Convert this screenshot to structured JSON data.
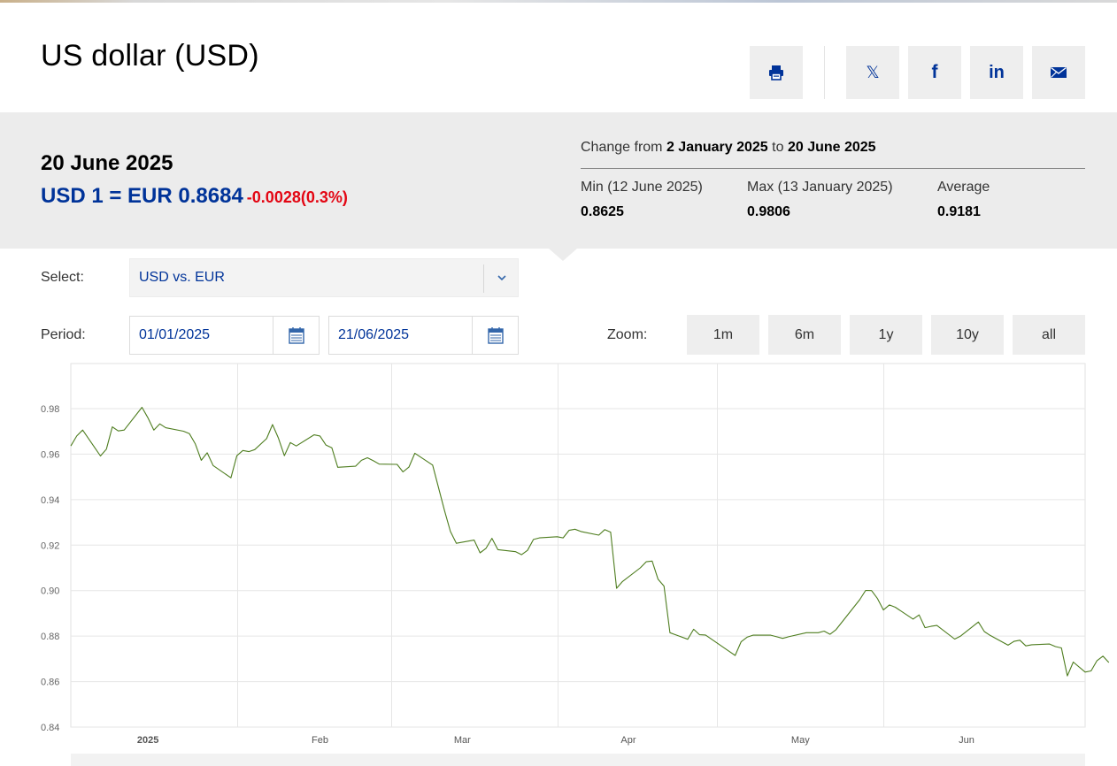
{
  "page": {
    "title": "US dollar (USD)"
  },
  "share": {
    "print_icon": "print-icon",
    "x_icon": "x-icon",
    "facebook_icon": "facebook-icon",
    "linkedin_icon": "linkedin-icon",
    "email_icon": "email-icon"
  },
  "summary": {
    "date": "20 June 2025",
    "rate": "USD 1 = EUR 0.8684",
    "change": "-0.0028(0.3%)",
    "change_color": "#e30613",
    "change_from_label": "Change from",
    "from_date": "2 January 2025",
    "to_label": "to",
    "to_date": "20 June 2025",
    "min_label": "Min (12 June 2025)",
    "min_value": "0.8625",
    "max_label": "Max (13 January 2025)",
    "max_value": "0.9806",
    "avg_label": "Average",
    "avg_value": "0.9181"
  },
  "form": {
    "select_label": "Select:",
    "select_value": "USD vs. EUR",
    "period_label": "Period:",
    "period_from": "01/01/2025",
    "period_to": "21/06/2025",
    "zoom_label": "Zoom:",
    "zoom_options": [
      "1m",
      "6m",
      "1y",
      "10y",
      "all"
    ]
  },
  "colors": {
    "brand": "#003399",
    "series": "#4e7d1f",
    "panel": "#ececec"
  },
  "chart_data": {
    "type": "line",
    "title": "",
    "xlabel": "",
    "ylabel": "",
    "ylim": [
      0.84,
      0.99
    ],
    "yticks": [
      "0.98",
      "0.96",
      "0.94",
      "0.92",
      "0.90",
      "0.88",
      "0.86",
      "0.84"
    ],
    "xticks": [
      "2025",
      "Feb",
      "Mar",
      "Apr",
      "May",
      "Jun"
    ],
    "xlim": [
      "2025-01-01",
      "2025-06-21"
    ],
    "grid": true,
    "series": [
      {
        "points": [
          [
            "2025-01-01",
            0.9636
          ],
          [
            "2025-01-02",
            0.968
          ],
          [
            "2025-01-03",
            0.9706
          ],
          [
            "2025-01-06",
            0.9592
          ],
          [
            "2025-01-07",
            0.9622
          ],
          [
            "2025-01-08",
            0.972
          ],
          [
            "2025-01-09",
            0.9702
          ],
          [
            "2025-01-10",
            0.9706
          ],
          [
            "2025-01-13",
            0.9806
          ],
          [
            "2025-01-14",
            0.976
          ],
          [
            "2025-01-15",
            0.9706
          ],
          [
            "2025-01-16",
            0.9733
          ],
          [
            "2025-01-17",
            0.9716
          ],
          [
            "2025-01-20",
            0.9701
          ],
          [
            "2025-01-21",
            0.969
          ],
          [
            "2025-01-22",
            0.9645
          ],
          [
            "2025-01-23",
            0.9573
          ],
          [
            "2025-01-24",
            0.9606
          ],
          [
            "2025-01-25",
            0.955
          ],
          [
            "2025-01-28",
            0.9496
          ],
          [
            "2025-01-29",
            0.9593
          ],
          [
            "2025-01-30",
            0.9616
          ],
          [
            "2025-01-31",
            0.9611
          ],
          [
            "2025-02-01",
            0.962
          ],
          [
            "2025-02-03",
            0.9668
          ],
          [
            "2025-02-04",
            0.973
          ],
          [
            "2025-02-05",
            0.967
          ],
          [
            "2025-02-06",
            0.9593
          ],
          [
            "2025-02-07",
            0.9651
          ],
          [
            "2025-02-08",
            0.9636
          ],
          [
            "2025-02-11",
            0.9685
          ],
          [
            "2025-02-12",
            0.968
          ],
          [
            "2025-02-13",
            0.964
          ],
          [
            "2025-02-14",
            0.9628
          ],
          [
            "2025-02-15",
            0.9542
          ],
          [
            "2025-02-18",
            0.9547
          ],
          [
            "2025-02-19",
            0.9573
          ],
          [
            "2025-02-20",
            0.9584
          ],
          [
            "2025-02-21",
            0.9571
          ],
          [
            "2025-02-22",
            0.9556
          ],
          [
            "2025-02-25",
            0.9555
          ],
          [
            "2025-02-26",
            0.9522
          ],
          [
            "2025-02-27",
            0.9543
          ],
          [
            "2025-02-28",
            0.9604
          ],
          [
            "2025-03-03",
            0.9552
          ],
          [
            "2025-03-05",
            0.9352
          ],
          [
            "2025-03-06",
            0.926
          ],
          [
            "2025-03-07",
            0.9208
          ],
          [
            "2025-03-10",
            0.9222
          ],
          [
            "2025-03-11",
            0.9166
          ],
          [
            "2025-03-12",
            0.9186
          ],
          [
            "2025-03-13",
            0.923
          ],
          [
            "2025-03-14",
            0.918
          ],
          [
            "2025-03-17",
            0.9171
          ],
          [
            "2025-03-18",
            0.9158
          ],
          [
            "2025-03-19",
            0.9177
          ],
          [
            "2025-03-20",
            0.9225
          ],
          [
            "2025-03-21",
            0.9232
          ],
          [
            "2025-03-24",
            0.9237
          ],
          [
            "2025-03-25",
            0.9232
          ],
          [
            "2025-03-26",
            0.9265
          ],
          [
            "2025-03-27",
            0.927
          ],
          [
            "2025-03-28",
            0.926
          ],
          [
            "2025-03-31",
            0.9244
          ],
          [
            "2025-04-01",
            0.9268
          ],
          [
            "2025-04-02",
            0.9257
          ],
          [
            "2025-04-03",
            0.901
          ],
          [
            "2025-04-04",
            0.904
          ],
          [
            "2025-04-07",
            0.91
          ],
          [
            "2025-04-08",
            0.9127
          ],
          [
            "2025-04-09",
            0.913
          ],
          [
            "2025-04-10",
            0.905
          ],
          [
            "2025-04-11",
            0.902
          ],
          [
            "2025-04-12",
            0.8815
          ],
          [
            "2025-04-15",
            0.8786
          ],
          [
            "2025-04-16",
            0.883
          ],
          [
            "2025-04-17",
            0.8806
          ],
          [
            "2025-04-18",
            0.8805
          ],
          [
            "2025-04-22",
            0.8733
          ],
          [
            "2025-04-23",
            0.8715
          ],
          [
            "2025-04-24",
            0.8775
          ],
          [
            "2025-04-25",
            0.8795
          ],
          [
            "2025-04-26",
            0.8804
          ],
          [
            "2025-04-29",
            0.8804
          ],
          [
            "2025-04-30",
            0.8797
          ],
          [
            "2025-05-01",
            0.879
          ],
          [
            "2025-05-02",
            0.8797
          ],
          [
            "2025-05-05",
            0.8815
          ],
          [
            "2025-05-06",
            0.8815
          ],
          [
            "2025-05-07",
            0.8815
          ],
          [
            "2025-05-08",
            0.8822
          ],
          [
            "2025-05-09",
            0.8808
          ],
          [
            "2025-05-10",
            0.8828
          ],
          [
            "2025-05-14",
            0.896
          ],
          [
            "2025-05-15",
            0.9001
          ],
          [
            "2025-05-16",
            0.9
          ],
          [
            "2025-05-17",
            0.8965
          ],
          [
            "2025-05-18",
            0.8915
          ],
          [
            "2025-05-19",
            0.8937
          ],
          [
            "2025-05-20",
            0.8927
          ],
          [
            "2025-05-23",
            0.8875
          ],
          [
            "2025-05-24",
            0.8893
          ],
          [
            "2025-05-25",
            0.8837
          ],
          [
            "2025-05-26",
            0.8843
          ],
          [
            "2025-05-27",
            0.8847
          ],
          [
            "2025-05-30",
            0.8787
          ],
          [
            "2025-05-31",
            0.88
          ],
          [
            "2025-06-03",
            0.8862
          ],
          [
            "2025-06-04",
            0.882
          ],
          [
            "2025-06-05",
            0.8803
          ],
          [
            "2025-06-08",
            0.876
          ],
          [
            "2025-06-09",
            0.8777
          ],
          [
            "2025-06-10",
            0.8782
          ],
          [
            "2025-06-11",
            0.8757
          ],
          [
            "2025-06-12",
            0.8762
          ],
          [
            "2025-06-15",
            0.8765
          ],
          [
            "2025-06-16",
            0.8754
          ],
          [
            "2025-06-17",
            0.8748
          ],
          [
            "2025-06-18",
            0.8625
          ],
          [
            "2025-06-19",
            0.8686
          ],
          [
            "2025-06-21",
            0.8642
          ],
          [
            "2025-06-22",
            0.8647
          ],
          [
            "2025-06-23",
            0.8692
          ],
          [
            "2025-06-24",
            0.8712
          ],
          [
            "2025-06-25",
            0.8684
          ]
        ]
      }
    ]
  }
}
